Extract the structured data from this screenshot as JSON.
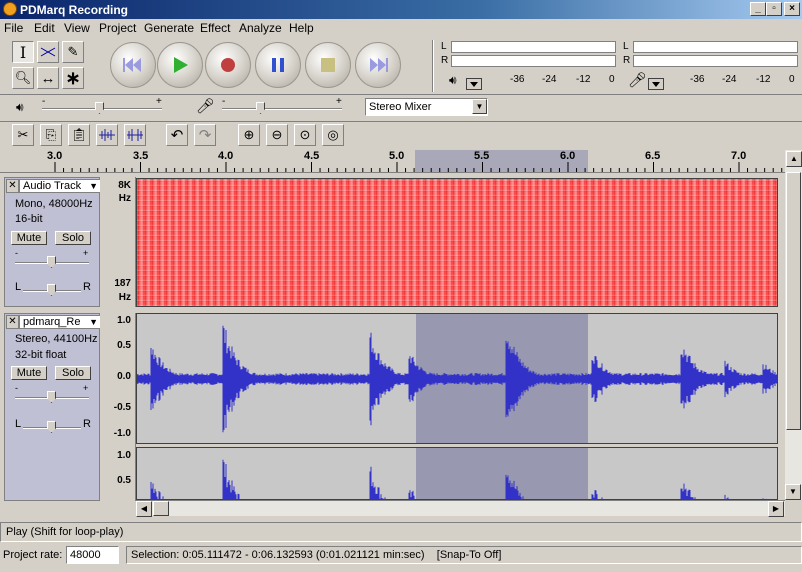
{
  "window": {
    "title": "PDMarq Recording",
    "minimize": "_",
    "maximize": "▫",
    "close": "×"
  },
  "menu": [
    "File",
    "Edit",
    "View",
    "Project",
    "Generate",
    "Effect",
    "Analyze",
    "Help"
  ],
  "meters": {
    "ticks": [
      "-36",
      "-24",
      "-12",
      "0"
    ],
    "ch_left": "L",
    "ch_right": "R"
  },
  "mixer": {
    "input_source": "Stereo Mixer",
    "minus": "-",
    "plus": "+"
  },
  "ruler": {
    "ticks": [
      "3.0",
      "3.5",
      "4.0",
      "4.5",
      "5.0",
      "5.5",
      "6.0",
      "6.5",
      "7.0"
    ]
  },
  "tracks": [
    {
      "name": "Audio Track",
      "info1": "Mono, 48000Hz",
      "info2": "16-bit",
      "mute": "Mute",
      "solo": "Solo",
      "minus": "-",
      "plus": "+",
      "pan_l": "L",
      "pan_r": "R",
      "scale_top": "8K",
      "scale_top_unit": "Hz",
      "scale_bottom": "187",
      "scale_bottom_unit": "Hz"
    },
    {
      "name": "pdmarq_Re",
      "info1": "Stereo, 44100Hz",
      "info2": "32-bit float",
      "mute": "Mute",
      "solo": "Solo",
      "minus": "-",
      "plus": "+",
      "pan_l": "L",
      "pan_r": "R",
      "scale": [
        "1.0",
        "0.5",
        "0.0",
        "-0.5",
        "-1.0"
      ],
      "scale2": [
        "1.0",
        "0.5"
      ]
    }
  ],
  "status": {
    "hint": "Play (Shift for loop-play)",
    "rate_label": "Project rate:",
    "rate": "48000",
    "selection": "Selection: 0:05.111472 - 0:06.132593 (0:01.021121 min:sec)    [Snap-To Off]"
  },
  "colors": {
    "spectrogram": "#ff2020",
    "waveform": "#3232c8",
    "selection": "#9898b0"
  }
}
